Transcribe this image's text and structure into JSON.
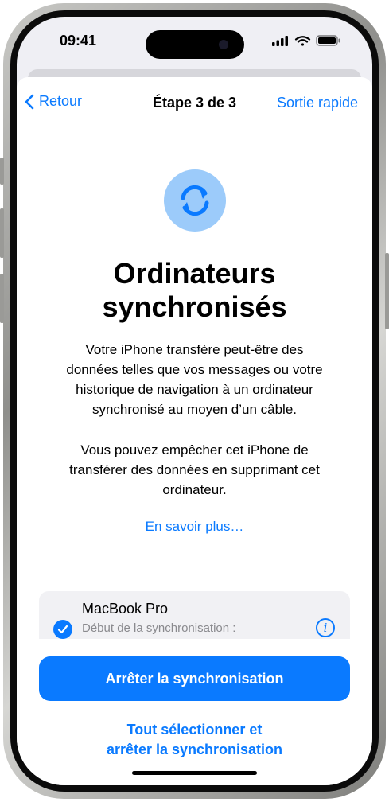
{
  "status_bar": {
    "time": "09:41"
  },
  "nav": {
    "back_label": "Retour",
    "title": "Étape 3 de 3",
    "exit_label": "Sortie rapide"
  },
  "main": {
    "title_line1": "Ordinateurs",
    "title_line2": "synchronisés",
    "paragraph1": [
      "Votre iPhone transfère peut-être des",
      "données telles que vos messages ou votre",
      "historique de navigation à un ordinateur",
      "synchronisé au moyen d’un câble."
    ],
    "paragraph2": [
      "Vous pouvez empêcher cet iPhone de",
      "transférer des données en supprimant cet",
      "ordinateur."
    ],
    "learn_more": "En savoir plus…"
  },
  "device": {
    "name": "MacBook Pro",
    "subtitle": "Début de la synchronisation :",
    "checked": true
  },
  "actions": {
    "primary_label": "Arrêter la synchronisation",
    "secondary_line1": "Tout sélectionner et",
    "secondary_line2": "arrêter la synchronisation"
  },
  "colors": {
    "accent": "#0a7aff",
    "icon_bg": "#9ccbfa"
  }
}
